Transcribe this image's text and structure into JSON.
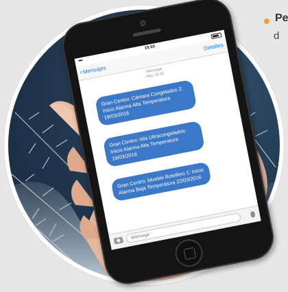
{
  "side_text": {
    "bold_fragment": "Pe",
    "second_line_fragment": "d"
  },
  "phone": {
    "status_bar": {
      "signal": "•••••",
      "time": "15:03"
    },
    "nav": {
      "back_label": "Mensajes",
      "details_label": "Detalles"
    },
    "conversation_header": {
      "line1": "iMessage",
      "line2": "Hoy, 15:42"
    },
    "messages": [
      "Gran Centro: Cámara Congelados 2: Inicio Alarma Alta Temperatura 19/03/2016",
      "Gran Centro: Isla Ultracongelados: Inicio Alarma Alta Temperatura 19/03/2016",
      "Gran Centro: Mueble Botellero 1: Inicio Alarma Baja Temperatura 22/03/2016"
    ],
    "input": {
      "placeholder": "iMessage"
    }
  },
  "colors": {
    "accent_blue": "#1e7cf2",
    "bubble_blue": "#3b78c7",
    "bullet_orange": "#f2a13a",
    "background_gray": "#e7e7e7"
  },
  "icons": [
    "chevron-left-icon",
    "battery-icon",
    "camera-icon",
    "mic-icon"
  ]
}
